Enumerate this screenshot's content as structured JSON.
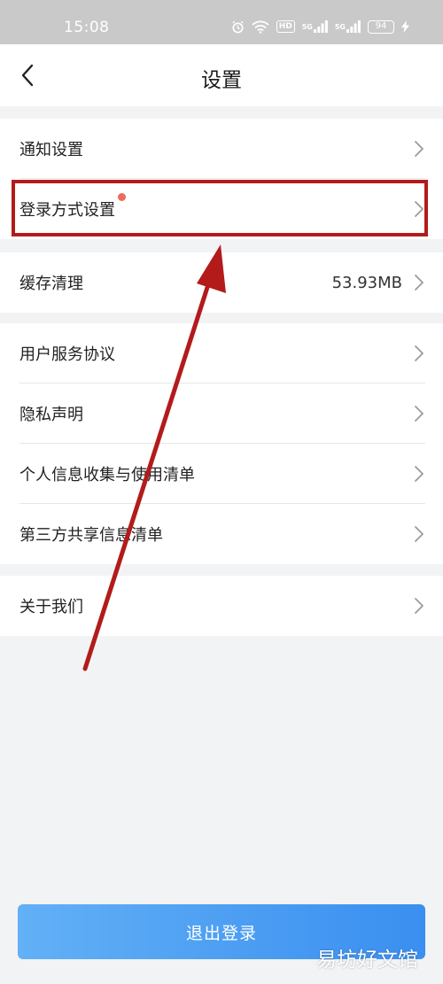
{
  "status_bar": {
    "time": "15:08",
    "battery": "94",
    "hd": "HD",
    "sig1": "5G",
    "sig2": "5G"
  },
  "header": {
    "title": "设置"
  },
  "groups": [
    {
      "items": [
        {
          "label": "通知设置"
        },
        {
          "label": "登录方式设置",
          "has_dot": true,
          "highlighted": true
        }
      ]
    },
    {
      "items": [
        {
          "label": "缓存清理",
          "value": "53.93MB"
        }
      ]
    },
    {
      "items": [
        {
          "label": "用户服务协议"
        },
        {
          "label": "隐私声明"
        },
        {
          "label": "个人信息收集与使用清单"
        },
        {
          "label": "第三方共享信息清单"
        }
      ]
    },
    {
      "items": [
        {
          "label": "关于我们"
        }
      ]
    }
  ],
  "logout_label": "退出登录",
  "watermark": "易坊好文馆",
  "colors": {
    "accent_start": "#62b0f6",
    "accent_end": "#3a8ff0",
    "annotation_red": "#b31b1b",
    "dot": "#ee6a5c"
  },
  "icons": {
    "back": "chevron-left-icon",
    "row": "chevron-right-icon"
  }
}
